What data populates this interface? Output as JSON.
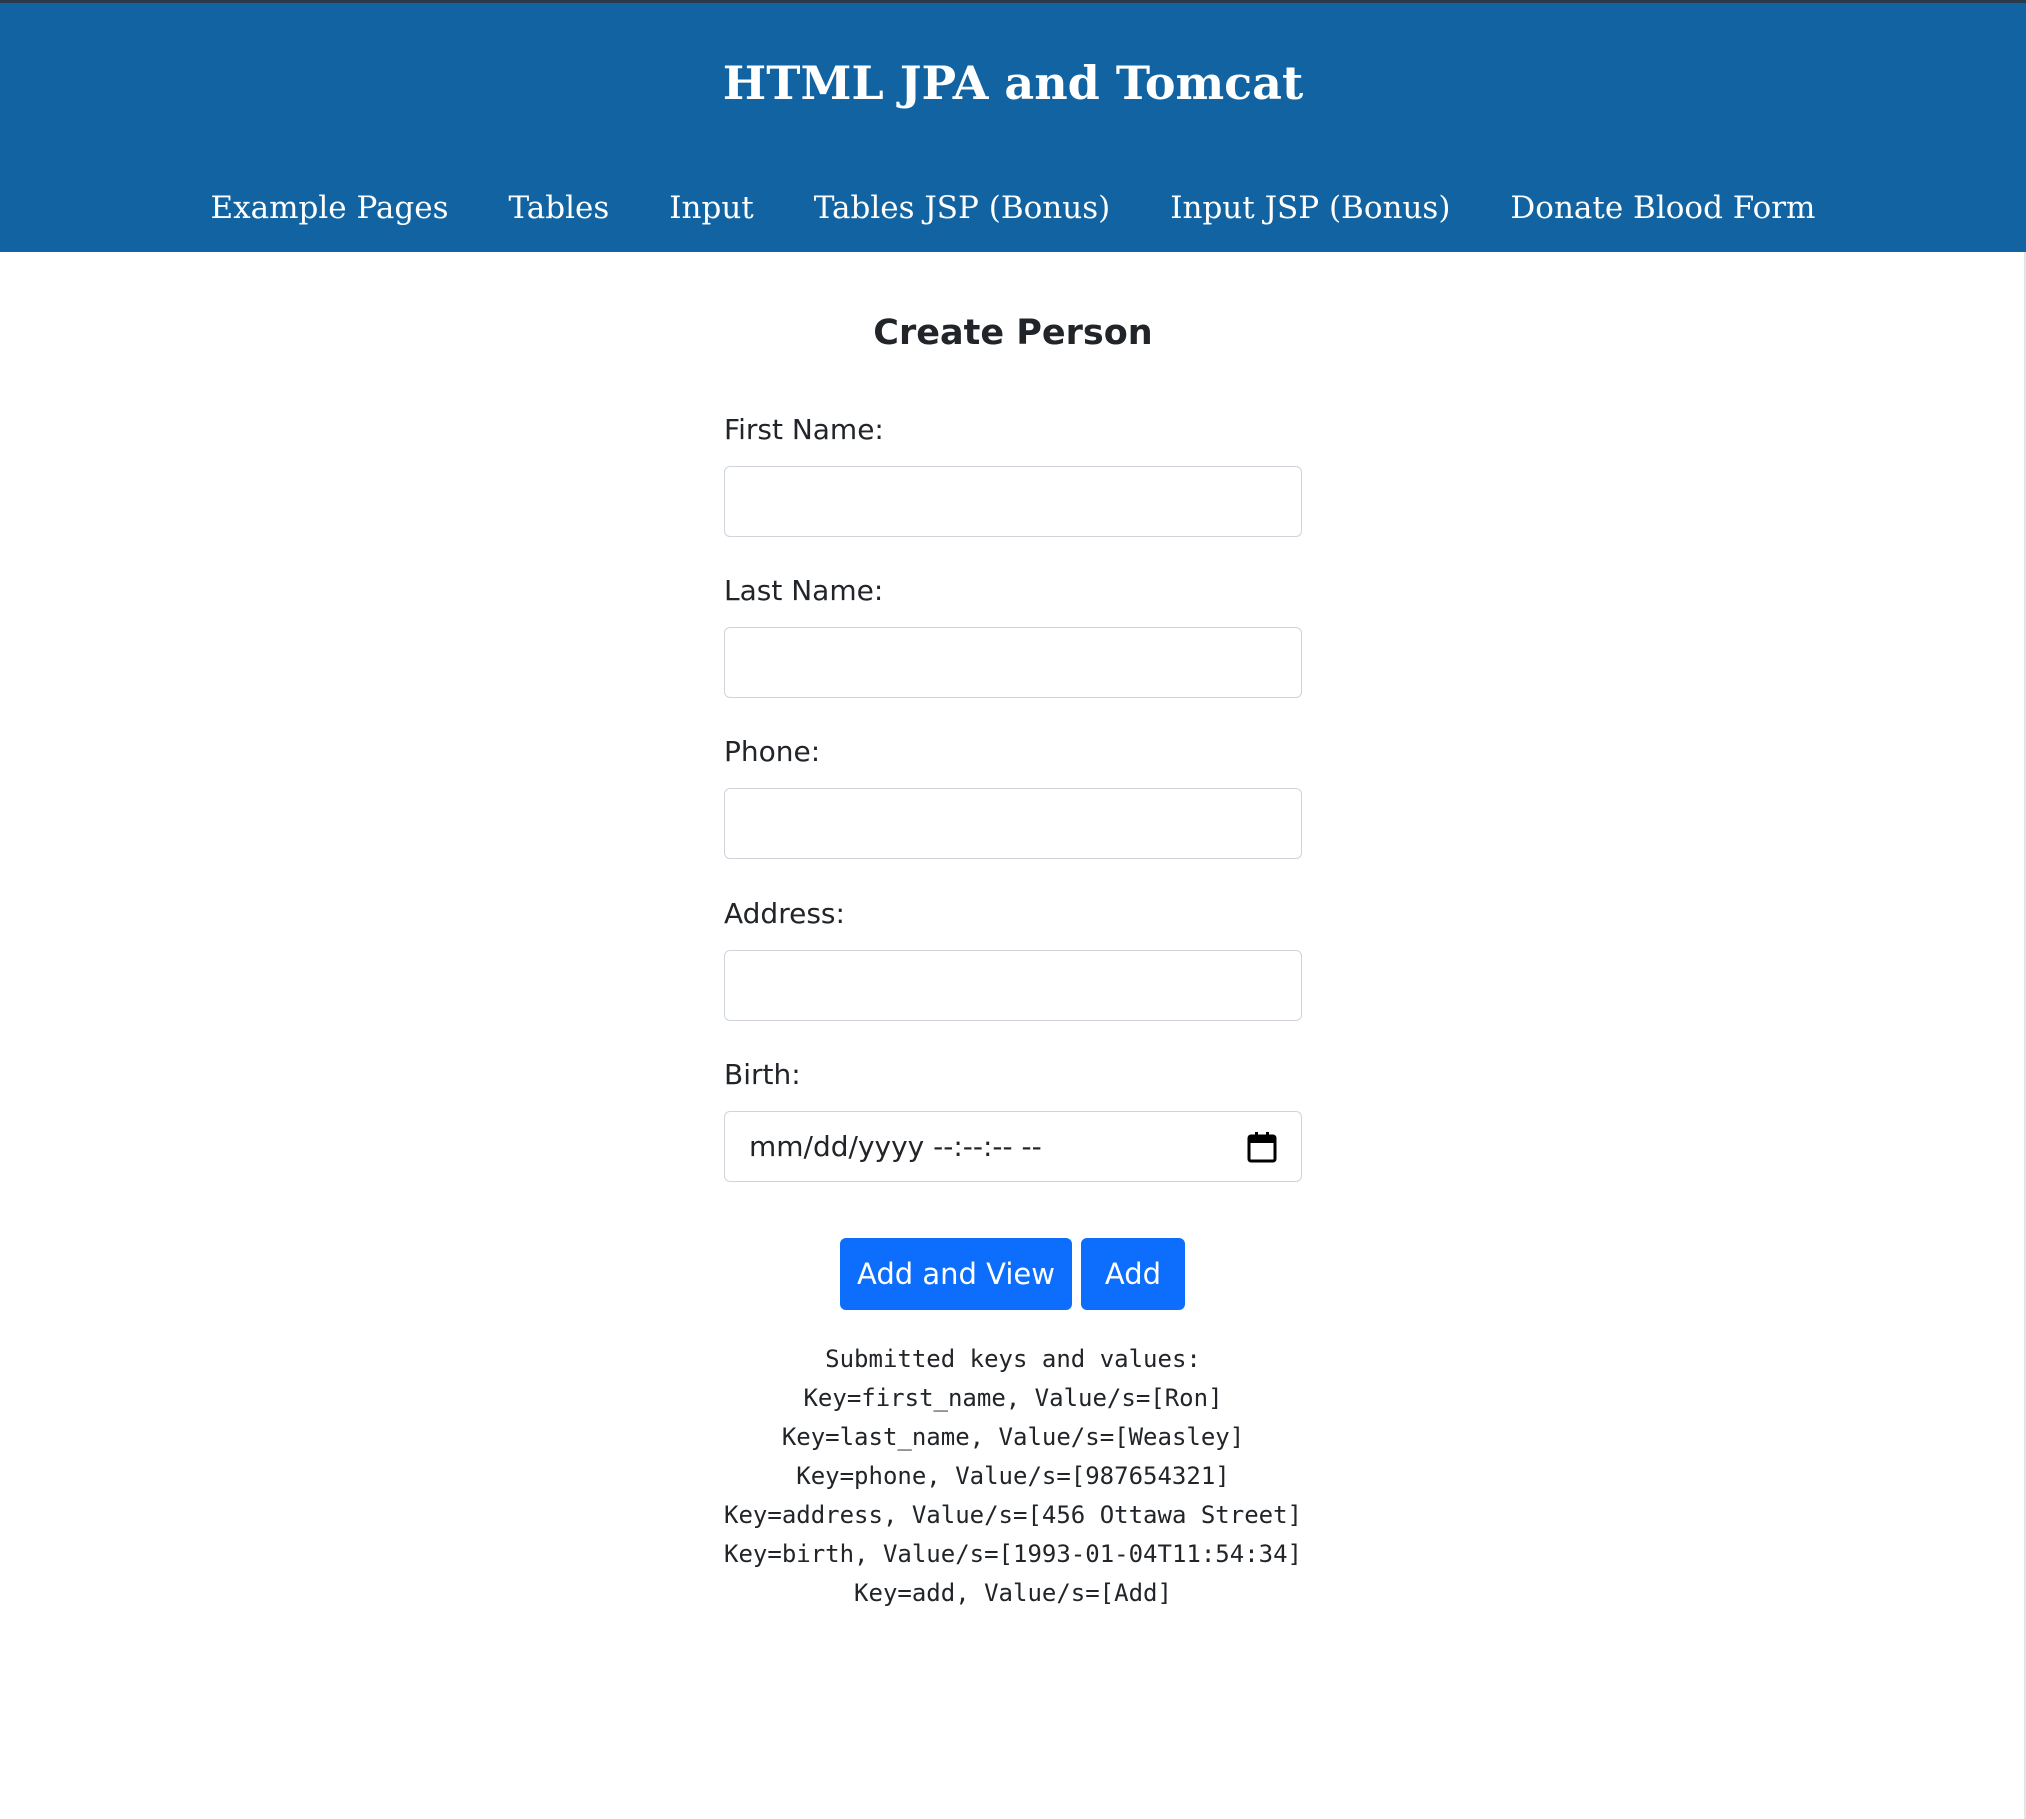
{
  "header": {
    "title": "HTML JPA and Tomcat",
    "nav": [
      {
        "label": "Example Pages"
      },
      {
        "label": "Tables"
      },
      {
        "label": "Input"
      },
      {
        "label": "Tables JSP (Bonus)"
      },
      {
        "label": "Input JSP (Bonus)"
      },
      {
        "label": "Donate Blood Form"
      }
    ]
  },
  "form": {
    "title": "Create Person",
    "fields": {
      "first_name": {
        "label": "First Name:",
        "value": ""
      },
      "last_name": {
        "label": "Last Name:",
        "value": ""
      },
      "phone": {
        "label": "Phone:",
        "value": ""
      },
      "address": {
        "label": "Address:",
        "value": ""
      },
      "birth": {
        "label": "Birth:",
        "placeholder": "mm/dd/yyyy --:--:-- --",
        "icon": "calendar-icon"
      }
    },
    "buttons": {
      "add_and_view": "Add and View",
      "add": "Add"
    }
  },
  "results": {
    "heading": "Submitted keys and values:",
    "lines": [
      "Key=first_name, Value/s=[Ron]",
      "Key=last_name, Value/s=[Weasley]",
      "Key=phone, Value/s=[987654321]",
      "Key=address, Value/s=[456 Ottawa Street]",
      "Key=birth, Value/s=[1993-01-04T11:54:34]",
      "Key=add, Value/s=[Add]"
    ]
  },
  "colors": {
    "header_bg": "#1263a1",
    "button_bg": "#0d6efd"
  }
}
